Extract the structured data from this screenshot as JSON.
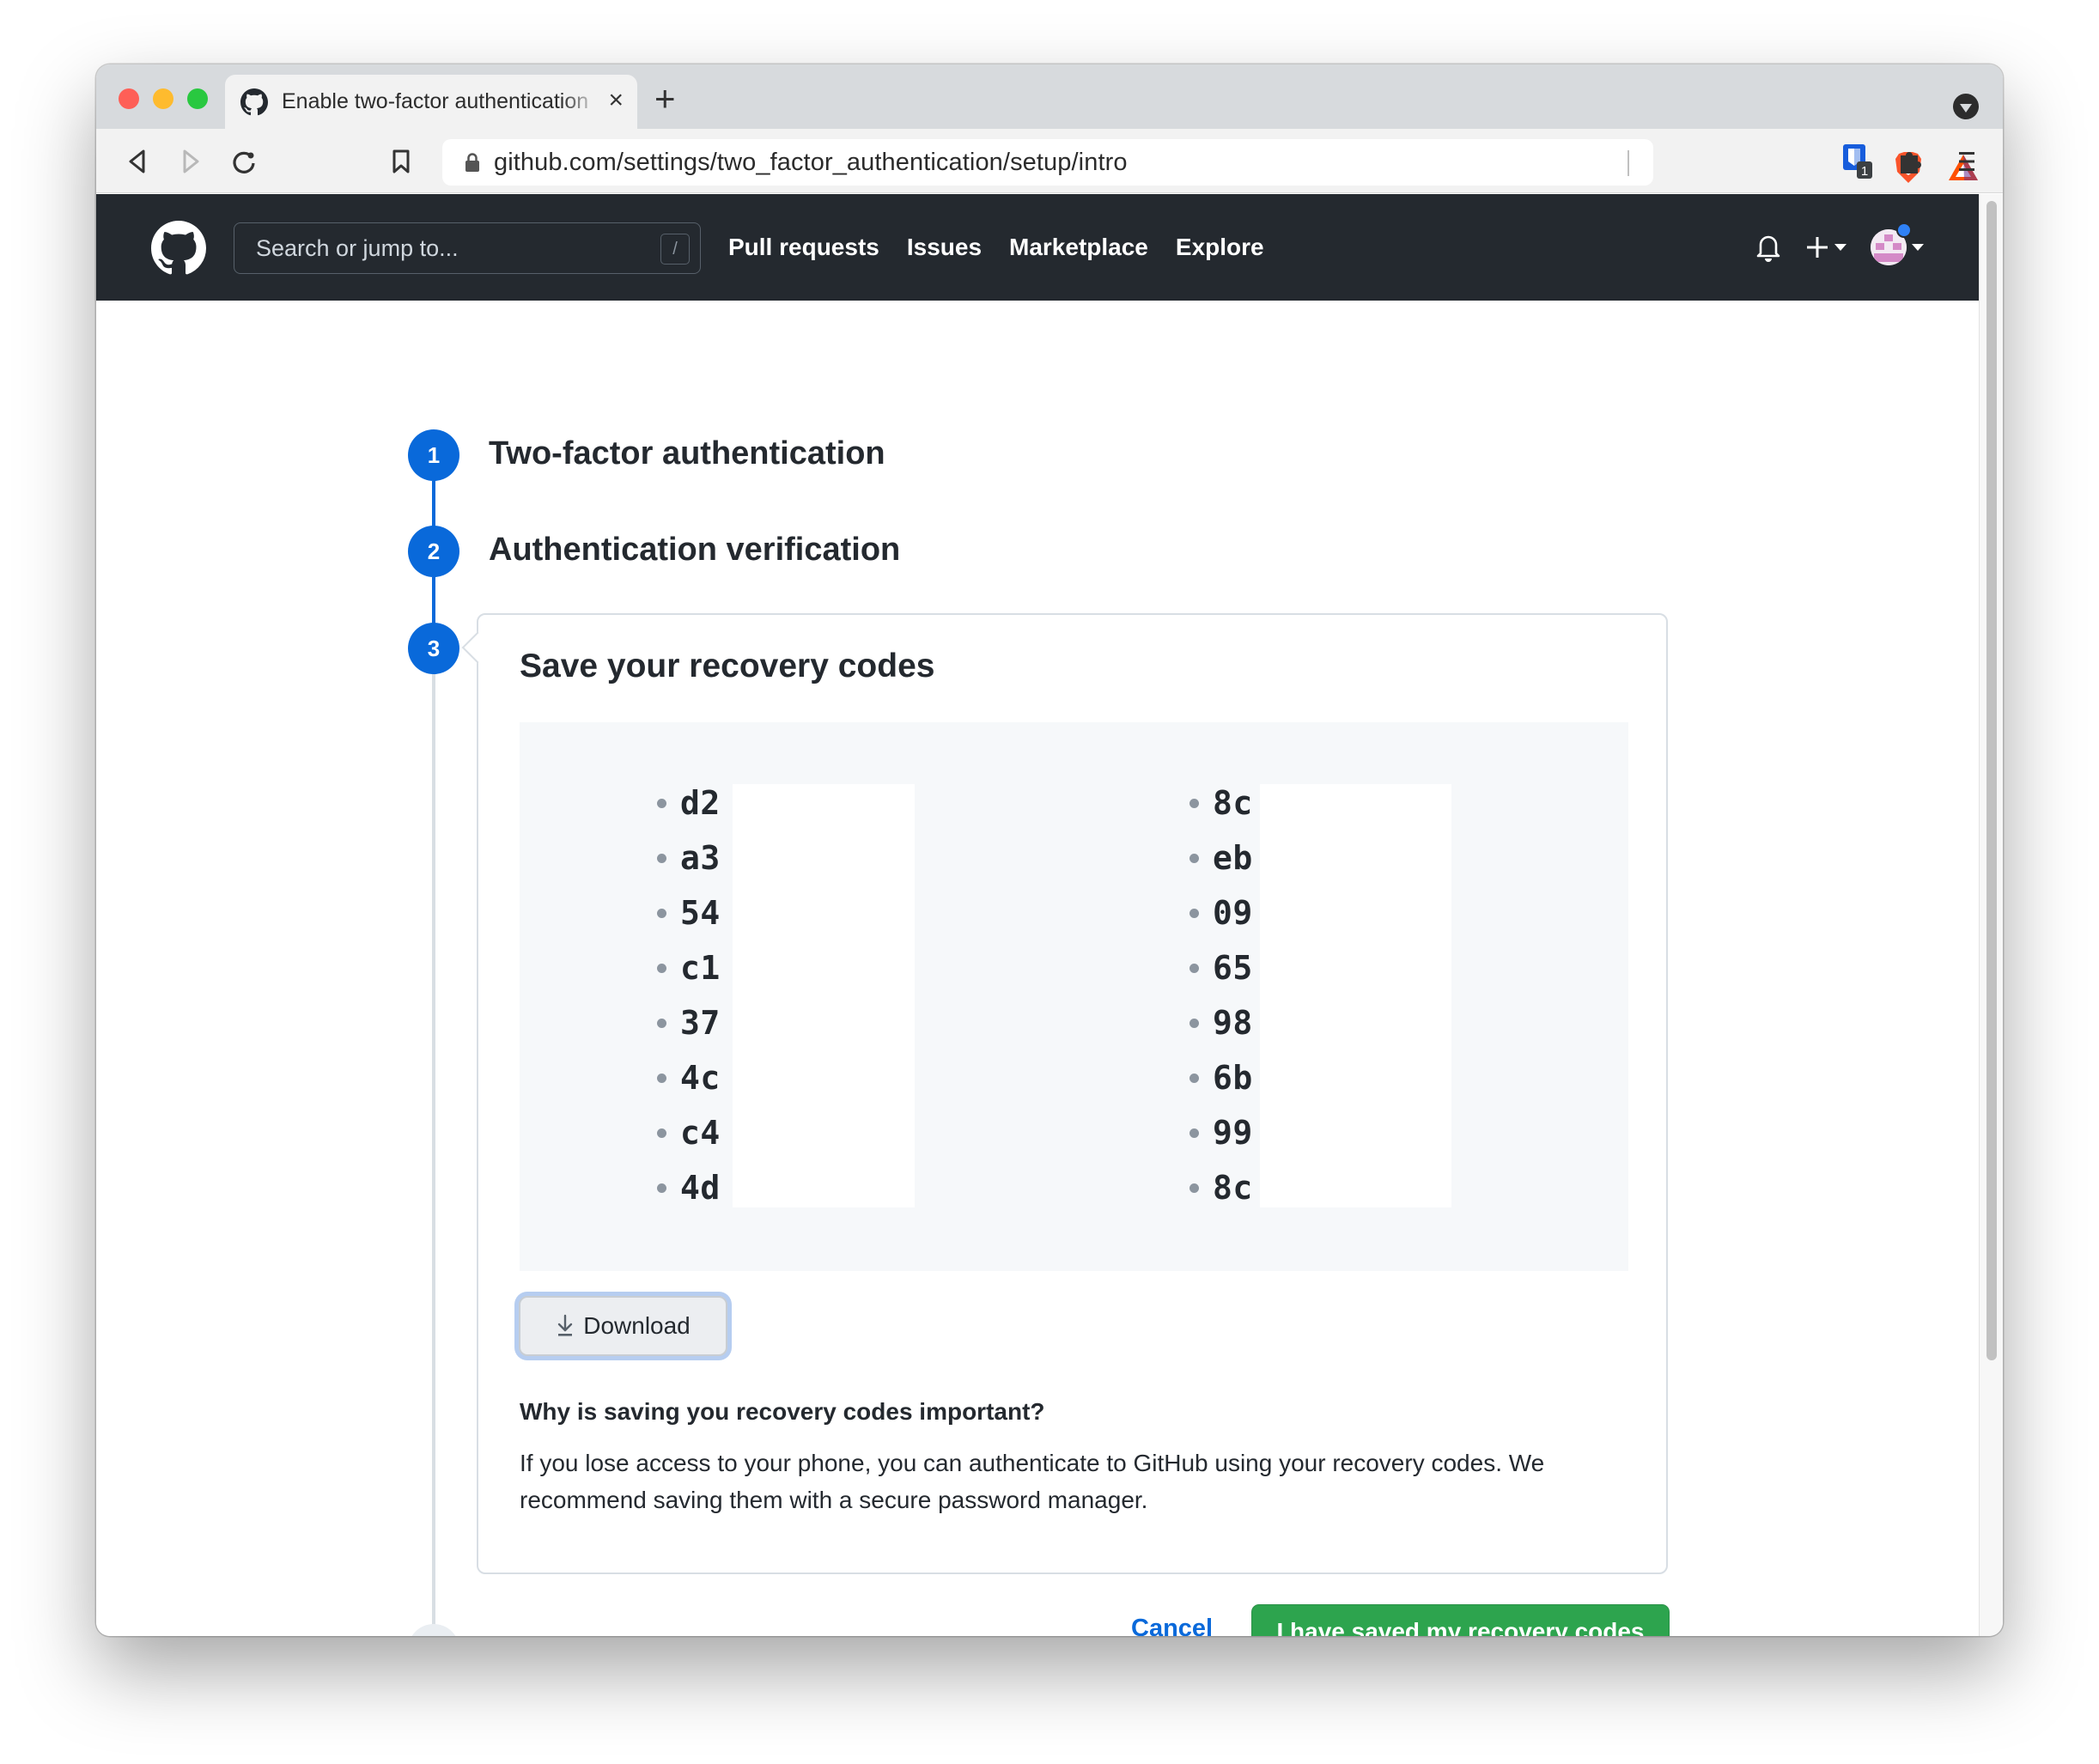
{
  "browser": {
    "tab_title": "Enable two-factor authentication",
    "new_tab_label": "+",
    "tab_close_label": "×",
    "url": "github.com/settings/two_factor_authentication/setup/intro",
    "extension_badge_count": "1"
  },
  "header": {
    "search_placeholder": "Search or jump to...",
    "search_shortcut": "/",
    "nav": [
      {
        "label": "Pull requests"
      },
      {
        "label": "Issues"
      },
      {
        "label": "Marketplace"
      },
      {
        "label": "Explore"
      }
    ],
    "create_label": "+"
  },
  "steps": [
    {
      "number": "1",
      "title": "Two-factor authentication",
      "state": "complete"
    },
    {
      "number": "2",
      "title": "Authentication verification",
      "state": "complete"
    },
    {
      "number": "3",
      "title": "Save your recovery codes",
      "state": "active"
    }
  ],
  "recovery": {
    "codes_left": [
      "d2",
      "a3",
      "54",
      "c1",
      "37",
      "4c",
      "c4",
      "4d"
    ],
    "codes_right": [
      "8c",
      "eb",
      "09",
      "65",
      "98",
      "6b",
      "99",
      "8c"
    ],
    "codes_redacted": true,
    "download_label": "Download",
    "why_heading": "Why is saving you recovery codes important?",
    "why_text": "If you lose access to your phone, you can authenticate to GitHub using your recovery codes. We recommend saving them with a secure password manager."
  },
  "actions": {
    "cancel_label": "Cancel",
    "confirm_label": "I have saved my recovery codes"
  },
  "colors": {
    "accent": "#0969da",
    "primary_button": "#2da44e",
    "header_bg": "#24292f"
  }
}
